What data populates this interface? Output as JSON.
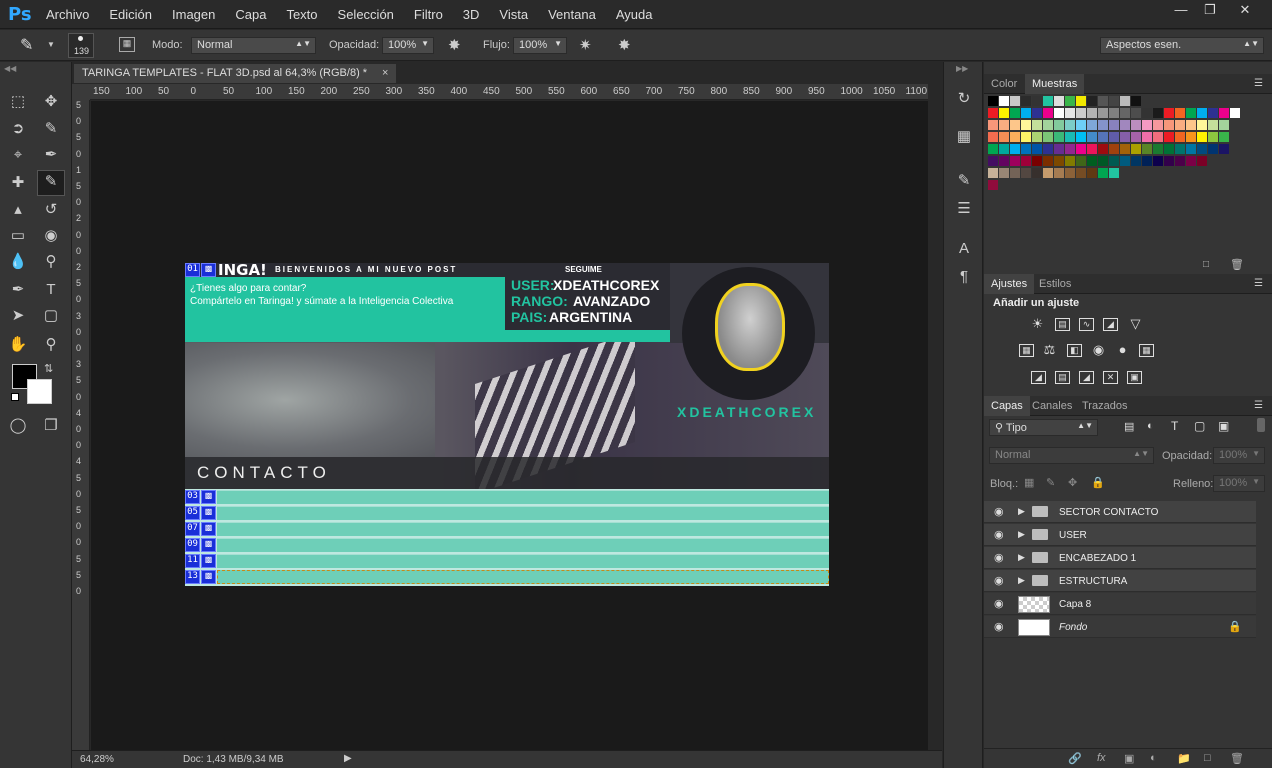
{
  "app": {
    "logo": "Ps"
  },
  "menu": [
    "Archivo",
    "Edición",
    "Imagen",
    "Capa",
    "Texto",
    "Selección",
    "Filtro",
    "3D",
    "Vista",
    "Ventana",
    "Ayuda"
  ],
  "options": {
    "brush_size": "139",
    "mode_label": "Modo:",
    "mode_value": "Normal",
    "opacity_label": "Opacidad:",
    "opacity_value": "100%",
    "flow_label": "Flujo:",
    "flow_value": "100%",
    "workspace": "Aspectos esen."
  },
  "document": {
    "tab_title": "TARINGA TEMPLATES - FLAT 3D.psd al 64,3% (RGB/8) *",
    "close_glyph": "×"
  },
  "ruler_top": [
    "150",
    "100",
    "50",
    "0",
    "50",
    "100",
    "150",
    "200",
    "250",
    "300",
    "350",
    "400",
    "450",
    "500",
    "550",
    "600",
    "650",
    "700",
    "750",
    "800",
    "850",
    "900",
    "950",
    "1000",
    "1050",
    "1100"
  ],
  "ruler_left": [
    "5",
    "0",
    "5",
    "0",
    "1",
    "5",
    "0",
    "2",
    "0",
    "0",
    "2",
    "5",
    "0",
    "3",
    "0",
    "0",
    "3",
    "5",
    "0",
    "4",
    "0",
    "0",
    "4",
    "5",
    "0",
    "5",
    "0",
    "0",
    "5",
    "5",
    "0"
  ],
  "artwork": {
    "logo_text": "INGA!",
    "welcome": "BIENVENIDOS A MI NUEVO POST",
    "tagline1": "¿Tienes algo para contar?",
    "tagline2": "Compártelo en Taringa! y súmate a la Inteligencia Colectiva",
    "follow": "SEGUIME",
    "user_label": "USER:",
    "user_value": "XDEATHCOREX",
    "rank_label": "RANGO:",
    "rank_value": "AVANZADO",
    "country_label": "PAIS:",
    "country_value": "ARGENTINA",
    "username_big": "XDEATHCOREX",
    "contact": "CONTACTO",
    "slice_top": "01",
    "slices": [
      "03",
      "05",
      "07",
      "09",
      "11",
      "13"
    ],
    "accent": "#22c3a0"
  },
  "status": {
    "zoom": "64,28%",
    "doc_info": "Doc: 1,43 MB/9,34 MB"
  },
  "color_panel": {
    "tab_color": "Color",
    "tab_swatches": "Muestras"
  },
  "adjust_panel": {
    "tab_adjust": "Ajustes",
    "tab_styles": "Estilos",
    "add_label": "Añadir un ajuste"
  },
  "layers_panel": {
    "tab_layers": "Capas",
    "tab_channels": "Canales",
    "tab_paths": "Trazados",
    "filter_kind": "Tipo",
    "blend": "Normal",
    "opacity_label": "Opacidad:",
    "opacity_value": "100%",
    "lock_label": "Bloq.:",
    "fill_label": "Relleno:",
    "fill_value": "100%",
    "layers": [
      {
        "name": "SECTOR CONTACTO"
      },
      {
        "name": "USER"
      },
      {
        "name": "ENCABEZADO 1"
      },
      {
        "name": "ESTRUCTURA"
      },
      {
        "name": "Capa 8"
      },
      {
        "name": "Fondo"
      }
    ]
  }
}
